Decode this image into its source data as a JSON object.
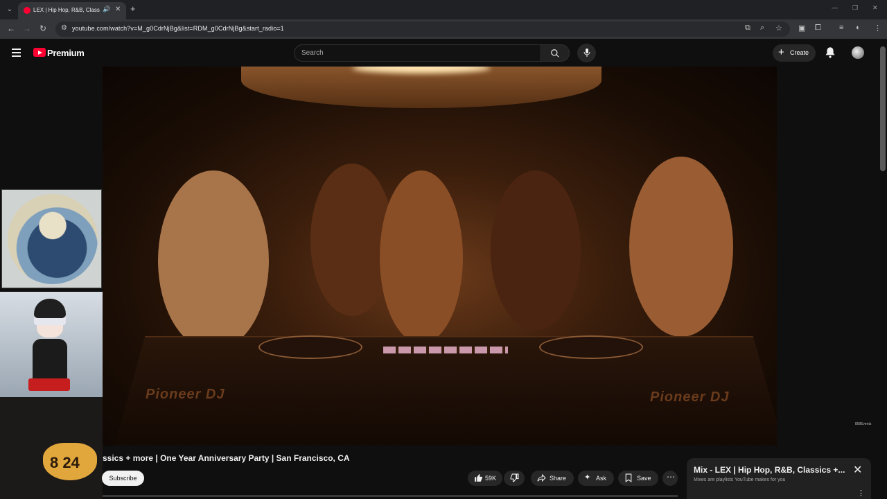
{
  "browser": {
    "tab_title": "LEX | Hip Hop, R&B, Classics",
    "new_tab": "+",
    "url": "youtube.com/watch?v=M_g0CdrNjBg&list=RDM_g0CdrNjBg&start_radio=1",
    "window_controls": [
      "—",
      "❐",
      "✕"
    ]
  },
  "youtube": {
    "brand": "Premium",
    "search_placeholder": "Search",
    "create_label": "Create"
  },
  "video": {
    "title": "ssics + more | One Year Anniversary Party | San Francisco, CA",
    "watermark": "IBBEvents",
    "deck_brand": "Pioneer DJ"
  },
  "actions": {
    "subscribe": "Subscribe",
    "likes": "59K",
    "share": "Share",
    "ask": "Ask",
    "save": "Save"
  },
  "mix_panel": {
    "title": "Mix - LEX | Hip Hop, R&B, Classics +...",
    "subtitle": "Mixes are playlists YouTube makes for you"
  },
  "side_thumbs": {
    "jersey_number": "8 24"
  },
  "colors": {
    "youtube_red": "#ff0033",
    "page_bg": "#0f0f0f",
    "chip_bg": "#272727"
  }
}
